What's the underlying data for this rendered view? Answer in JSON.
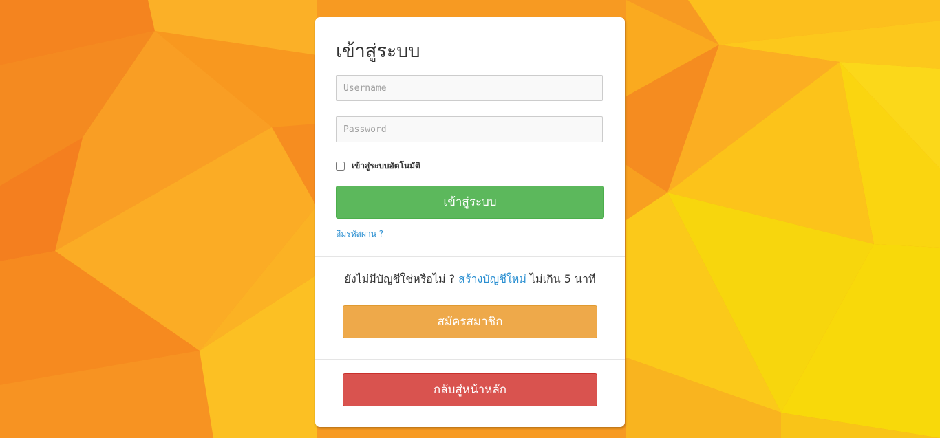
{
  "login": {
    "title": "เข้าสู่ระบบ",
    "username_placeholder": "Username",
    "password_placeholder": "Password",
    "remember_label": "เข้าสู่ระบบอัตโนมัติ",
    "login_button": "เข้าสู่ระบบ",
    "forgot_link": "ลืมรหัสผ่าน ?"
  },
  "signup": {
    "prompt_before": "ยังไม่มีบัญชีใช่หรือไม่ ?",
    "create_link": "สร้างบัญชีใหม่",
    "prompt_after": "ไม่เกิน 5 นาที",
    "register_button": "สมัครสมาชิก"
  },
  "footer": {
    "home_button": "กลับสู่หน้าหลัก"
  },
  "colors": {
    "success": "#5cb85c",
    "warning": "#eea94a",
    "danger": "#d9534f",
    "link": "#2a8fd1",
    "background_orange": "#f7a51f",
    "background_yellow": "#f8d80a"
  }
}
